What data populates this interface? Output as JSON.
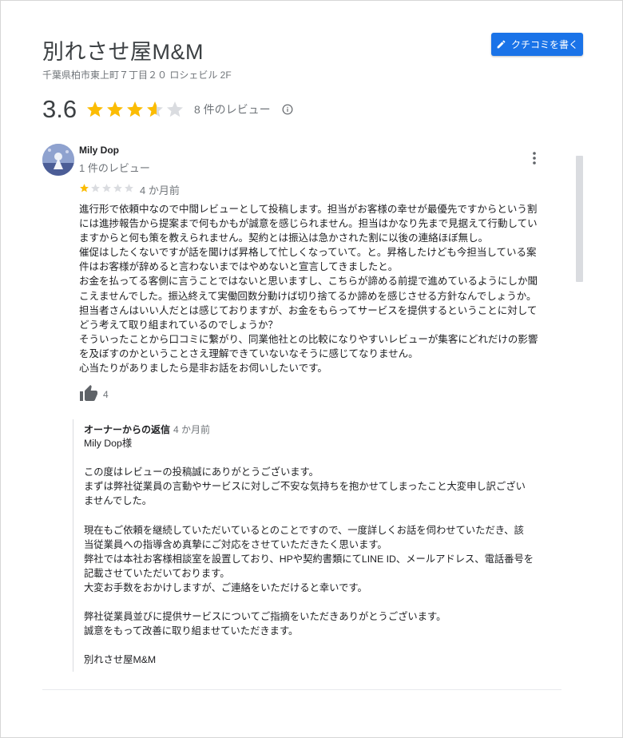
{
  "place": {
    "title": "別れさせ屋M&M",
    "address": "千葉県柏市東上町７丁目２０ ロシェビル 2F",
    "write_review_label": "クチコミを書く"
  },
  "summary": {
    "rating": "3.6",
    "rating_value": 3.6,
    "review_count": "8 件のレビュー"
  },
  "review": {
    "author": "Mily Dop",
    "author_meta": "1 件のレビュー",
    "rating_value": 1,
    "date": "4 か月前",
    "lines": [
      "進行形で依頼中なので中間レビューとして投稿します。担当がお客様の幸せが最優先ですからという割",
      "には進捗報告から提案まで何もかもが誠意を感じられません。担当はかなり先まで見据えて行動してい",
      "ますからと何も策を教えられません。契約とは振込は急かされた割に以後の連絡ほぼ無し。",
      "催促はしたくないですが話を聞けば昇格して忙しくなっていて。と。昇格したけども今担当している案",
      "件はお客様が辞めると言わないまではやめないと宣言してきましたと。",
      "お金を払ってる客側に言うことではないと思いますし、こちらが諦める前提で進めているようにしか聞",
      "こえませんでした。振込終えて実働回数分動けば切り捨てるか諦めを感じさせる方針なんでしょうか。",
      "担当者さんはいい人だとは感じておりますが、お金をもらってサービスを提供するということに対して",
      "どう考えて取り組まれているのでしょうか？",
      "そういったことから口コミに繋がり、同業他社との比較になりやすいレビューが集客にどれだけの影響",
      "を及ぼすのかということさえ理解できていないなそうに感じてなりません。",
      "心当たりがありましたら是非お話をお伺いしたいです。"
    ],
    "likes": "4"
  },
  "owner_reply": {
    "label": "オーナーからの返信",
    "date": "4 か月前",
    "lines": [
      "Mily Dop様",
      "",
      "この度はレビューの投稿誠にありがとうございます。",
      "まずは弊社従業員の言動やサービスに対しご不安な気持ちを抱かせてしまったこと大変申し訳ござい",
      "ませんでした。",
      "",
      "現在もご依頼を継続していただいているとのことですので、一度詳しくお話を伺わせていただき、該",
      "当従業員への指導含め真摯にご対応をさせていただきたく思います。",
      "弊社では本社お客様相談室を設置しており、HPや契約書類にてLINE ID、メールアドレス、電話番号を",
      "記載させていただいております。",
      "大変お手数をおかけしますが、ご連絡をいただけると幸いです。",
      "",
      "弊社従業員並びに提供サービスについてご指摘をいただきありがとうございます。",
      "誠意をもって改善に取り組ませていただきます。",
      "",
      "別れさせ屋M&M"
    ]
  },
  "colors": {
    "star_filled": "#fbbc04",
    "star_empty": "#dadce0",
    "accent": "#1a73e8"
  }
}
